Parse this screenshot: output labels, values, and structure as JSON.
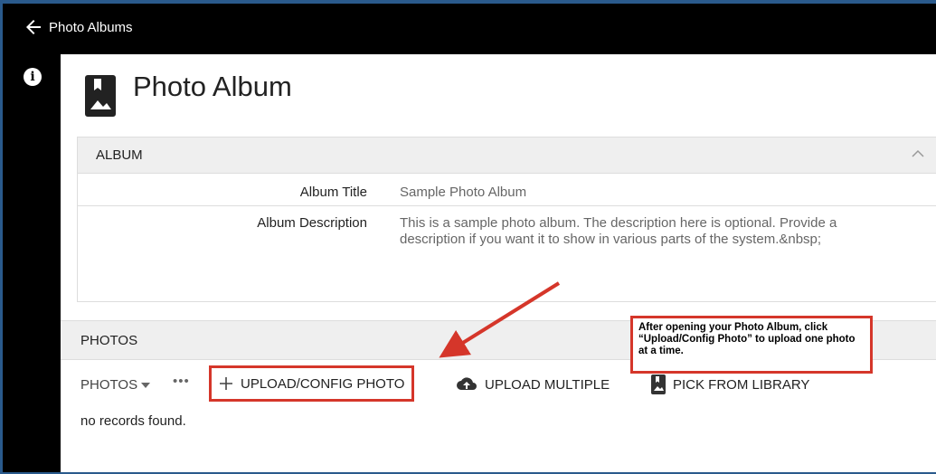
{
  "header": {
    "title": "Photo Albums"
  },
  "page": {
    "title": "Photo Album"
  },
  "album": {
    "section_label": "ALBUM",
    "title_label": "Album Title",
    "title_value": "Sample Photo Album",
    "description_label": "Album Description",
    "description_value": "This is a sample photo album. The description here is optional. Provide a description if you want it to show in various parts of the system.&nbsp;"
  },
  "photos": {
    "section_label": "PHOTOS",
    "dropdown_label": "PHOTOS",
    "more_label": "•••",
    "upload_config_label": "UPLOAD/CONFIG PHOTO",
    "upload_multiple_label": "UPLOAD MULTIPLE",
    "pick_library_label": "PICK FROM LIBRARY",
    "empty_text": "no records found."
  },
  "callout": {
    "text": "After opening your Photo Album, click “Upload/Config Photo” to upload one photo at a time."
  },
  "colors": {
    "highlight": "#d5362a",
    "background": "#2a5a8c"
  },
  "icons": [
    "back-arrow-icon",
    "info-icon",
    "photo-album-icon",
    "chevron-up-icon",
    "plus-icon",
    "cloud-upload-icon",
    "library-icon"
  ]
}
